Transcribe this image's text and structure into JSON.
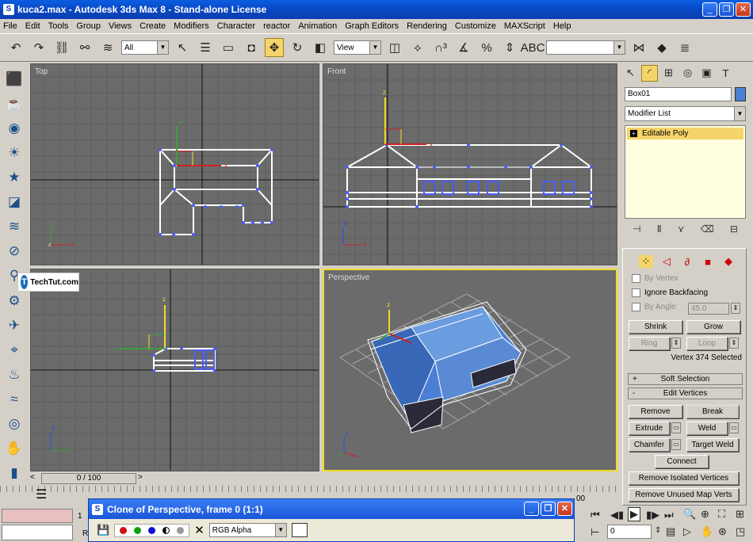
{
  "window": {
    "title": "kuca2.max - Autodesk 3ds Max 8 - Stand-alone License"
  },
  "menu": [
    "File",
    "Edit",
    "Tools",
    "Group",
    "Views",
    "Create",
    "Modifiers",
    "Character",
    "reactor",
    "Animation",
    "Graph Editors",
    "Rendering",
    "Customize",
    "MAXScript",
    "Help"
  ],
  "toolbar": {
    "selection_filter": "All",
    "ref_coord": "View"
  },
  "viewports": {
    "top": "Top",
    "front": "Front",
    "left": "",
    "perspective": "Perspective"
  },
  "command_panel": {
    "object_name": "Box01",
    "modifier_list": "Modifier List",
    "stack_item": "Editable Poly",
    "by_vertex": "By Vertex",
    "ignore_backfacing": "Ignore Backfacing",
    "by_angle": "By Angle:",
    "angle_value": "45.0",
    "shrink": "Shrink",
    "grow": "Grow",
    "ring": "Ring",
    "loop": "Loop",
    "selected_status": "Vertex 374 Selected",
    "soft_selection": "Soft Selection",
    "edit_vertices": "Edit Vertices",
    "remove": "Remove",
    "break": "Break",
    "extrude": "Extrude",
    "weld": "Weld",
    "chamfer": "Chamfer",
    "target_weld": "Target Weld",
    "connect": "Connect",
    "remove_isolated": "Remove Isolated Vertices",
    "remove_unused": "Remove Unused Map Verts",
    "plus": "+",
    "minus": "-"
  },
  "timeline": {
    "frame": "0 / 100",
    "ruler_end": "00"
  },
  "clone_window": {
    "title": "Clone of Perspective, frame 0 (1:1)",
    "channel": "RGB Alpha"
  },
  "status": {
    "frame_field": "0",
    "left_num": "1",
    "r_label": "R"
  },
  "watermark": {
    "text": "TechTut.com"
  }
}
